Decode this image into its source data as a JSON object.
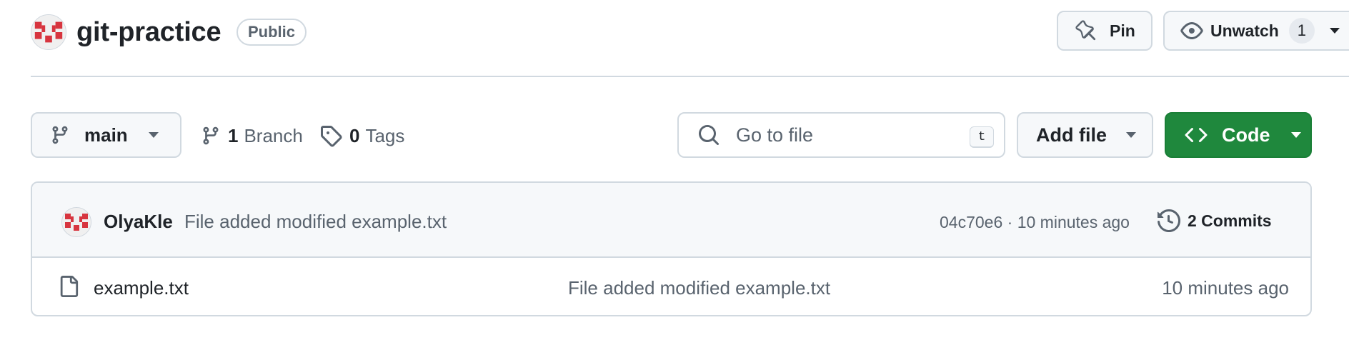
{
  "repo": {
    "name": "git-practice",
    "visibility": "Public"
  },
  "header_actions": {
    "pin_label": "Pin",
    "unwatch_label": "Unwatch",
    "watchers_count": "1"
  },
  "toolbar": {
    "branch_name": "main",
    "branches_count": "1",
    "branches_label": "Branch",
    "tags_count": "0",
    "tags_label": "Tags",
    "search_placeholder": "Go to file",
    "search_shortcut": "t",
    "add_file_label": "Add file",
    "code_label": "Code"
  },
  "latest_commit": {
    "author": "OlyaKle",
    "message": "File added modified example.txt",
    "hash": "04c70e6",
    "separator": "·",
    "age": "10 minutes ago",
    "commits_count_label": "2 Commits"
  },
  "files": [
    {
      "name": "example.txt",
      "commit_message": "File added modified example.txt",
      "age": "10 minutes ago"
    }
  ],
  "colors": {
    "primary_green": "#1f883d",
    "avatar_red": "#d7353f",
    "border": "#d1d9e0",
    "muted_text": "#59636e"
  },
  "icons": [
    "repo-avatar",
    "pin-icon",
    "eye-icon",
    "git-branch-icon",
    "tag-icon",
    "search-icon",
    "code-icon",
    "history-icon",
    "file-icon",
    "chevron-down-icon"
  ]
}
